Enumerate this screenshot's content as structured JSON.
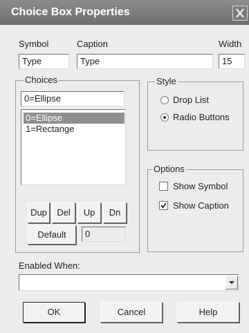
{
  "dialog": {
    "title": "Choice Box Properties",
    "close_glyph": "X"
  },
  "fields": {
    "symbol_label": "Symbol",
    "symbol_value": "Type",
    "caption_label": "Caption",
    "caption_value": "Type",
    "width_label": "Width",
    "width_value": "15"
  },
  "choices": {
    "group_label": "Choices",
    "edit_value": "0=Ellipse",
    "items": [
      "0=Ellipse",
      "1=Rectange"
    ],
    "selected_index": 0,
    "buttons": {
      "dup": "Dup",
      "del": "Del",
      "up": "Up",
      "dn": "Dn"
    },
    "default_button": "Default",
    "default_value": "0"
  },
  "style": {
    "group_label": "Style",
    "options": [
      "Drop List",
      "Radio Buttons"
    ],
    "selected": "Radio Buttons"
  },
  "options": {
    "group_label": "Options",
    "show_symbol_label": "Show Symbol",
    "show_symbol_checked": false,
    "show_caption_label": "Show Caption",
    "show_caption_checked": true
  },
  "enabled_when": {
    "label": "Enabled When:",
    "value": ""
  },
  "footer": {
    "ok": "OK",
    "cancel": "Cancel",
    "help": "Help"
  },
  "colors": {
    "titlebar": "#7f7f7f",
    "selection": "#8f8f8f",
    "face": "#ececea"
  },
  "icons": {
    "close": "close-icon",
    "combo": "chevron-down-icon",
    "check": "checkmark-icon"
  }
}
